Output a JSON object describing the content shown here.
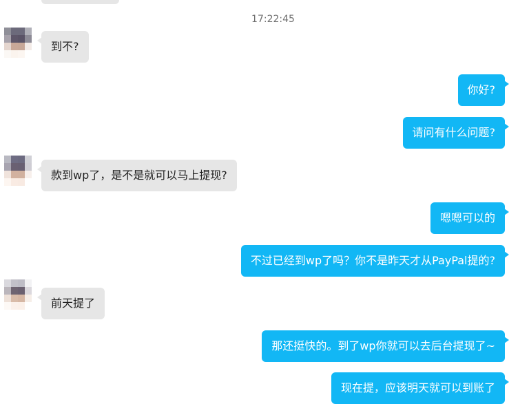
{
  "chat": {
    "timestamp": "17:22:45",
    "messages": [
      {
        "side": "incoming",
        "text": "到不?"
      },
      {
        "side": "outgoing",
        "text": "你好?"
      },
      {
        "side": "outgoing",
        "text": "请问有什么问题?"
      },
      {
        "side": "incoming",
        "text": "款到wp了，是不是就可以马上提现?"
      },
      {
        "side": "outgoing",
        "text": "嗯嗯可以的"
      },
      {
        "side": "outgoing",
        "text": "不过已经到wp了吗？你不是昨天才从PayPal提的?"
      },
      {
        "side": "incoming",
        "text": "前天提了"
      },
      {
        "side": "outgoing",
        "text": "那还挺快的。到了wp你就可以去后台提现了~"
      },
      {
        "side": "outgoing",
        "text": "现在提，应该明天就可以到账了"
      }
    ]
  },
  "colors": {
    "outgoing_bubble": "#12b7f5",
    "incoming_bubble": "#e6e6e6",
    "timestamp_text": "#707070"
  },
  "icons": {
    "avatar": "avatar-icon"
  }
}
